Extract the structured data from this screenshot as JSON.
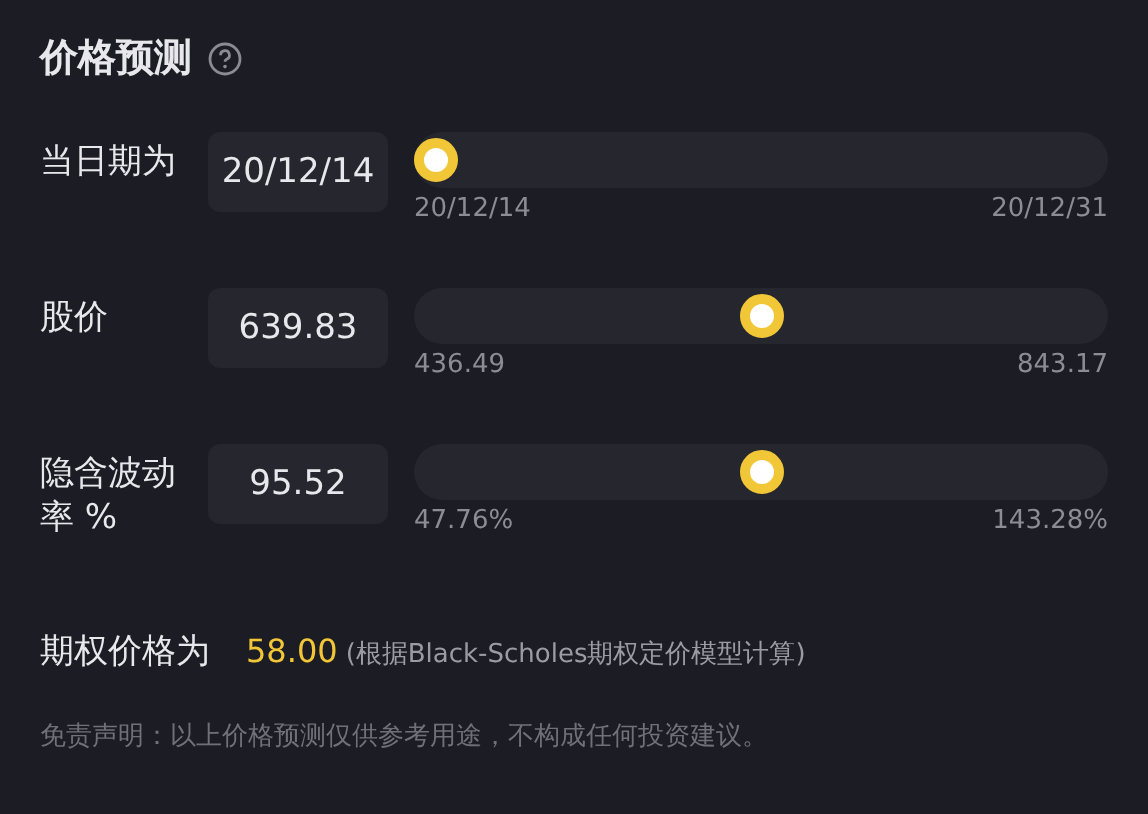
{
  "title": "价格预测",
  "rows": [
    {
      "label": "当日期为",
      "value": "20/12/14",
      "level": 0,
      "min": "20/12/14",
      "max": "20/12/31"
    },
    {
      "label": "股价",
      "value": "639.83",
      "level": 0.5,
      "min": "436.49",
      "max": "843.17"
    },
    {
      "label": "隐含波动率 %",
      "value": "95.52",
      "level": 0.5,
      "min": "47.76%",
      "max": "143.28%"
    }
  ],
  "result": {
    "label": "期权价格为",
    "value": "58.00",
    "note": "(根据Black-Scholes期权定价模型计算)"
  },
  "disclaimer": "免责声明：以上价格预测仅供参考用途，不构成任何投资建议。"
}
